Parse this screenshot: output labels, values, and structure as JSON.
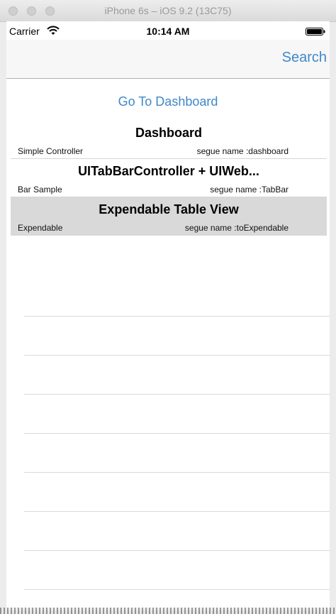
{
  "window": {
    "title": "iPhone 6s – iOS 9.2 (13C75)"
  },
  "status_bar": {
    "carrier": "Carrier",
    "time": "10:14 AM",
    "icons": [
      "wifi-icon",
      "battery-icon"
    ]
  },
  "nav_bar": {
    "search_label": "Search"
  },
  "go_to_dashboard_label": "Go To Dashboard",
  "rows": [
    {
      "title": "Dashboard",
      "subtitle": "Simple Controller",
      "detail": "segue name :dashboard",
      "selected": false
    },
    {
      "title": "UITabBarController + UIWeb...",
      "subtitle": "Bar Sample",
      "detail": "segue name :TabBar",
      "selected": false
    },
    {
      "title": "Expendable Table View",
      "subtitle": "Expendable",
      "detail": "segue name :toExpendable",
      "selected": true
    }
  ],
  "colors": {
    "tint": "#3f88c8",
    "selected_row": "#d9d9d9",
    "separator": "#d6d6d6"
  }
}
